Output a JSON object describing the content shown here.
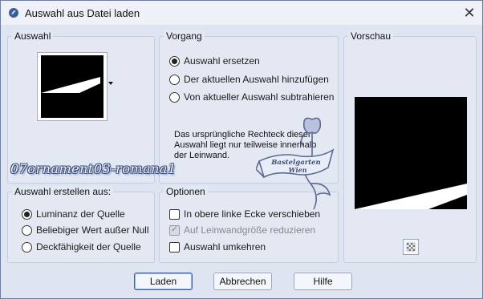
{
  "window": {
    "title": "Auswahl aus Datei laden",
    "close_label": "✕"
  },
  "auswahl_group": {
    "label": "Auswahl"
  },
  "vorgang_group": {
    "label": "Vorgang",
    "options": [
      {
        "label": "Auswahl ersetzen",
        "selected": true
      },
      {
        "label": "Der aktuellen Auswahl hinzufügen",
        "selected": false
      },
      {
        "label": "Von aktueller Auswahl subtrahieren",
        "selected": false
      }
    ],
    "info": "Das ursprüngliche Rechteck dieser Auswahl liegt nur teilweise innerhalb der Leinwand."
  },
  "vorschau_group": {
    "label": "Vorschau"
  },
  "erstellen_group": {
    "label": "Auswahl erstellen aus:",
    "options": [
      {
        "label": "Luminanz der Quelle",
        "selected": true
      },
      {
        "label": "Beliebiger Wert außer Null",
        "selected": false
      },
      {
        "label": "Deckfähigkeit der Quelle",
        "selected": false
      }
    ]
  },
  "optionen_group": {
    "label": "Optionen",
    "options": [
      {
        "label": "In obere linke Ecke verschieben",
        "checked": false,
        "disabled": false
      },
      {
        "label": "Auf Leinwandgröße reduzieren",
        "checked": true,
        "disabled": true
      },
      {
        "label": "Auswahl umkehren",
        "checked": false,
        "disabled": false
      }
    ]
  },
  "buttons": {
    "load": "Laden",
    "cancel": "Abbrechen",
    "help": "Hilfe"
  },
  "watermark": {
    "text": "07ornament03-romana1",
    "logo_line1": "Bastelgarten",
    "logo_line2": "Wien"
  },
  "colors": {
    "accent": "#3a5fad",
    "window_bg": "#dfe4f1",
    "titlebar_bg": "#eef1f8",
    "logo": "#5a6a94"
  }
}
